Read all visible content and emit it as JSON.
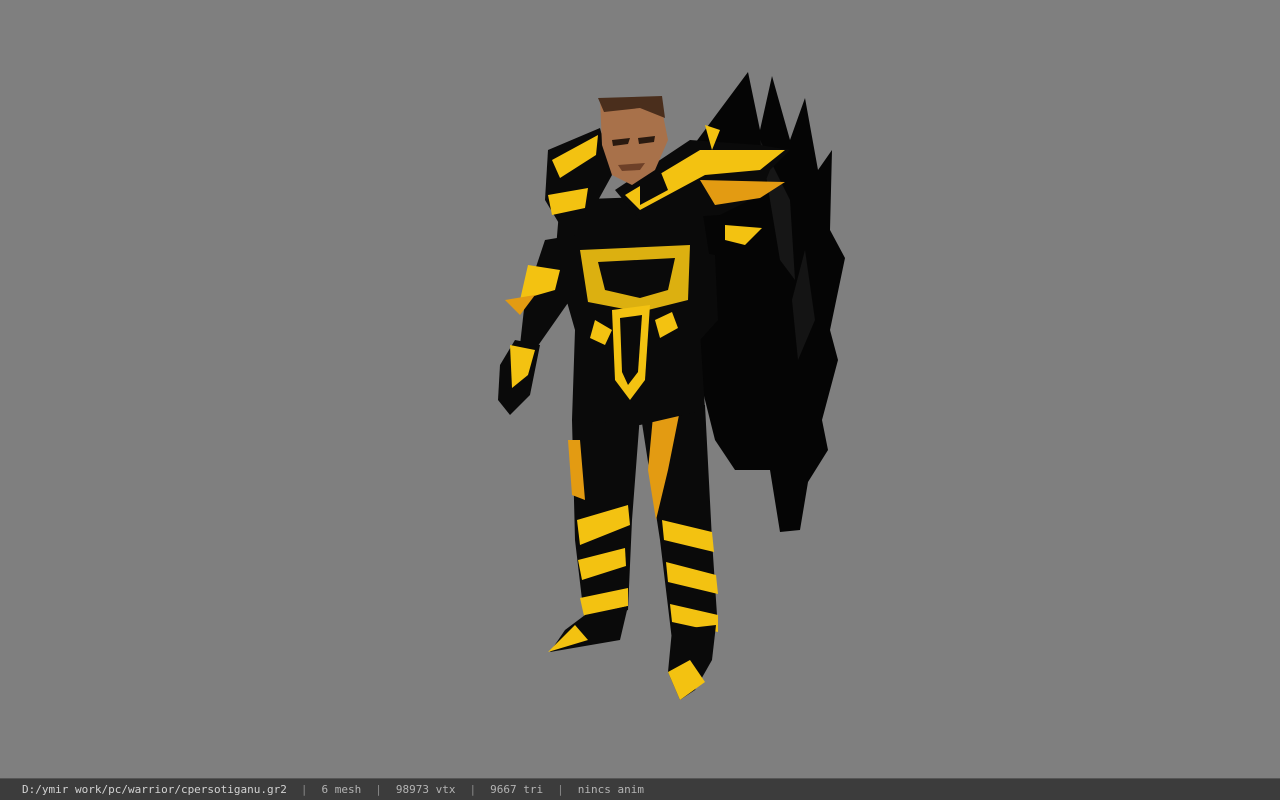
{
  "viewport": {
    "background": "#7f7f7f",
    "model_colors": {
      "armor_black": "#0a0a0a",
      "armor_gold": "#f3c211",
      "armor_orange": "#e39b12",
      "skin": "#a8714a",
      "hair": "#4a2e1c"
    }
  },
  "status": {
    "file_path": "D:/ymir work/pc/warrior/cpersotiganu.gr2",
    "separator": "|",
    "mesh_count": "6 mesh",
    "vertex_count": "98973 vtx",
    "triangle_count": "9667 tri",
    "anim_state": "nincs anim"
  }
}
